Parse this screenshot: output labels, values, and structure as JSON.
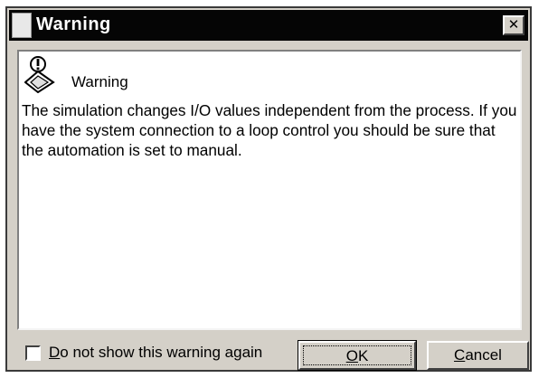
{
  "dialog": {
    "title": "Warning",
    "close_label": "✕",
    "content": {
      "icon": "warning-icon",
      "heading": "Warning",
      "message": "The simulation changes I/O values independent from the process. If you have the system connection to a loop control you should be sure that the automation is set to manual."
    },
    "checkbox": {
      "checked": false,
      "label_mnemonic": "D",
      "label_rest": "o not show this warning again"
    },
    "ok_button": {
      "mnemonic": "O",
      "rest": "K"
    },
    "cancel_button": {
      "mnemonic": "C",
      "rest": "ancel"
    }
  }
}
